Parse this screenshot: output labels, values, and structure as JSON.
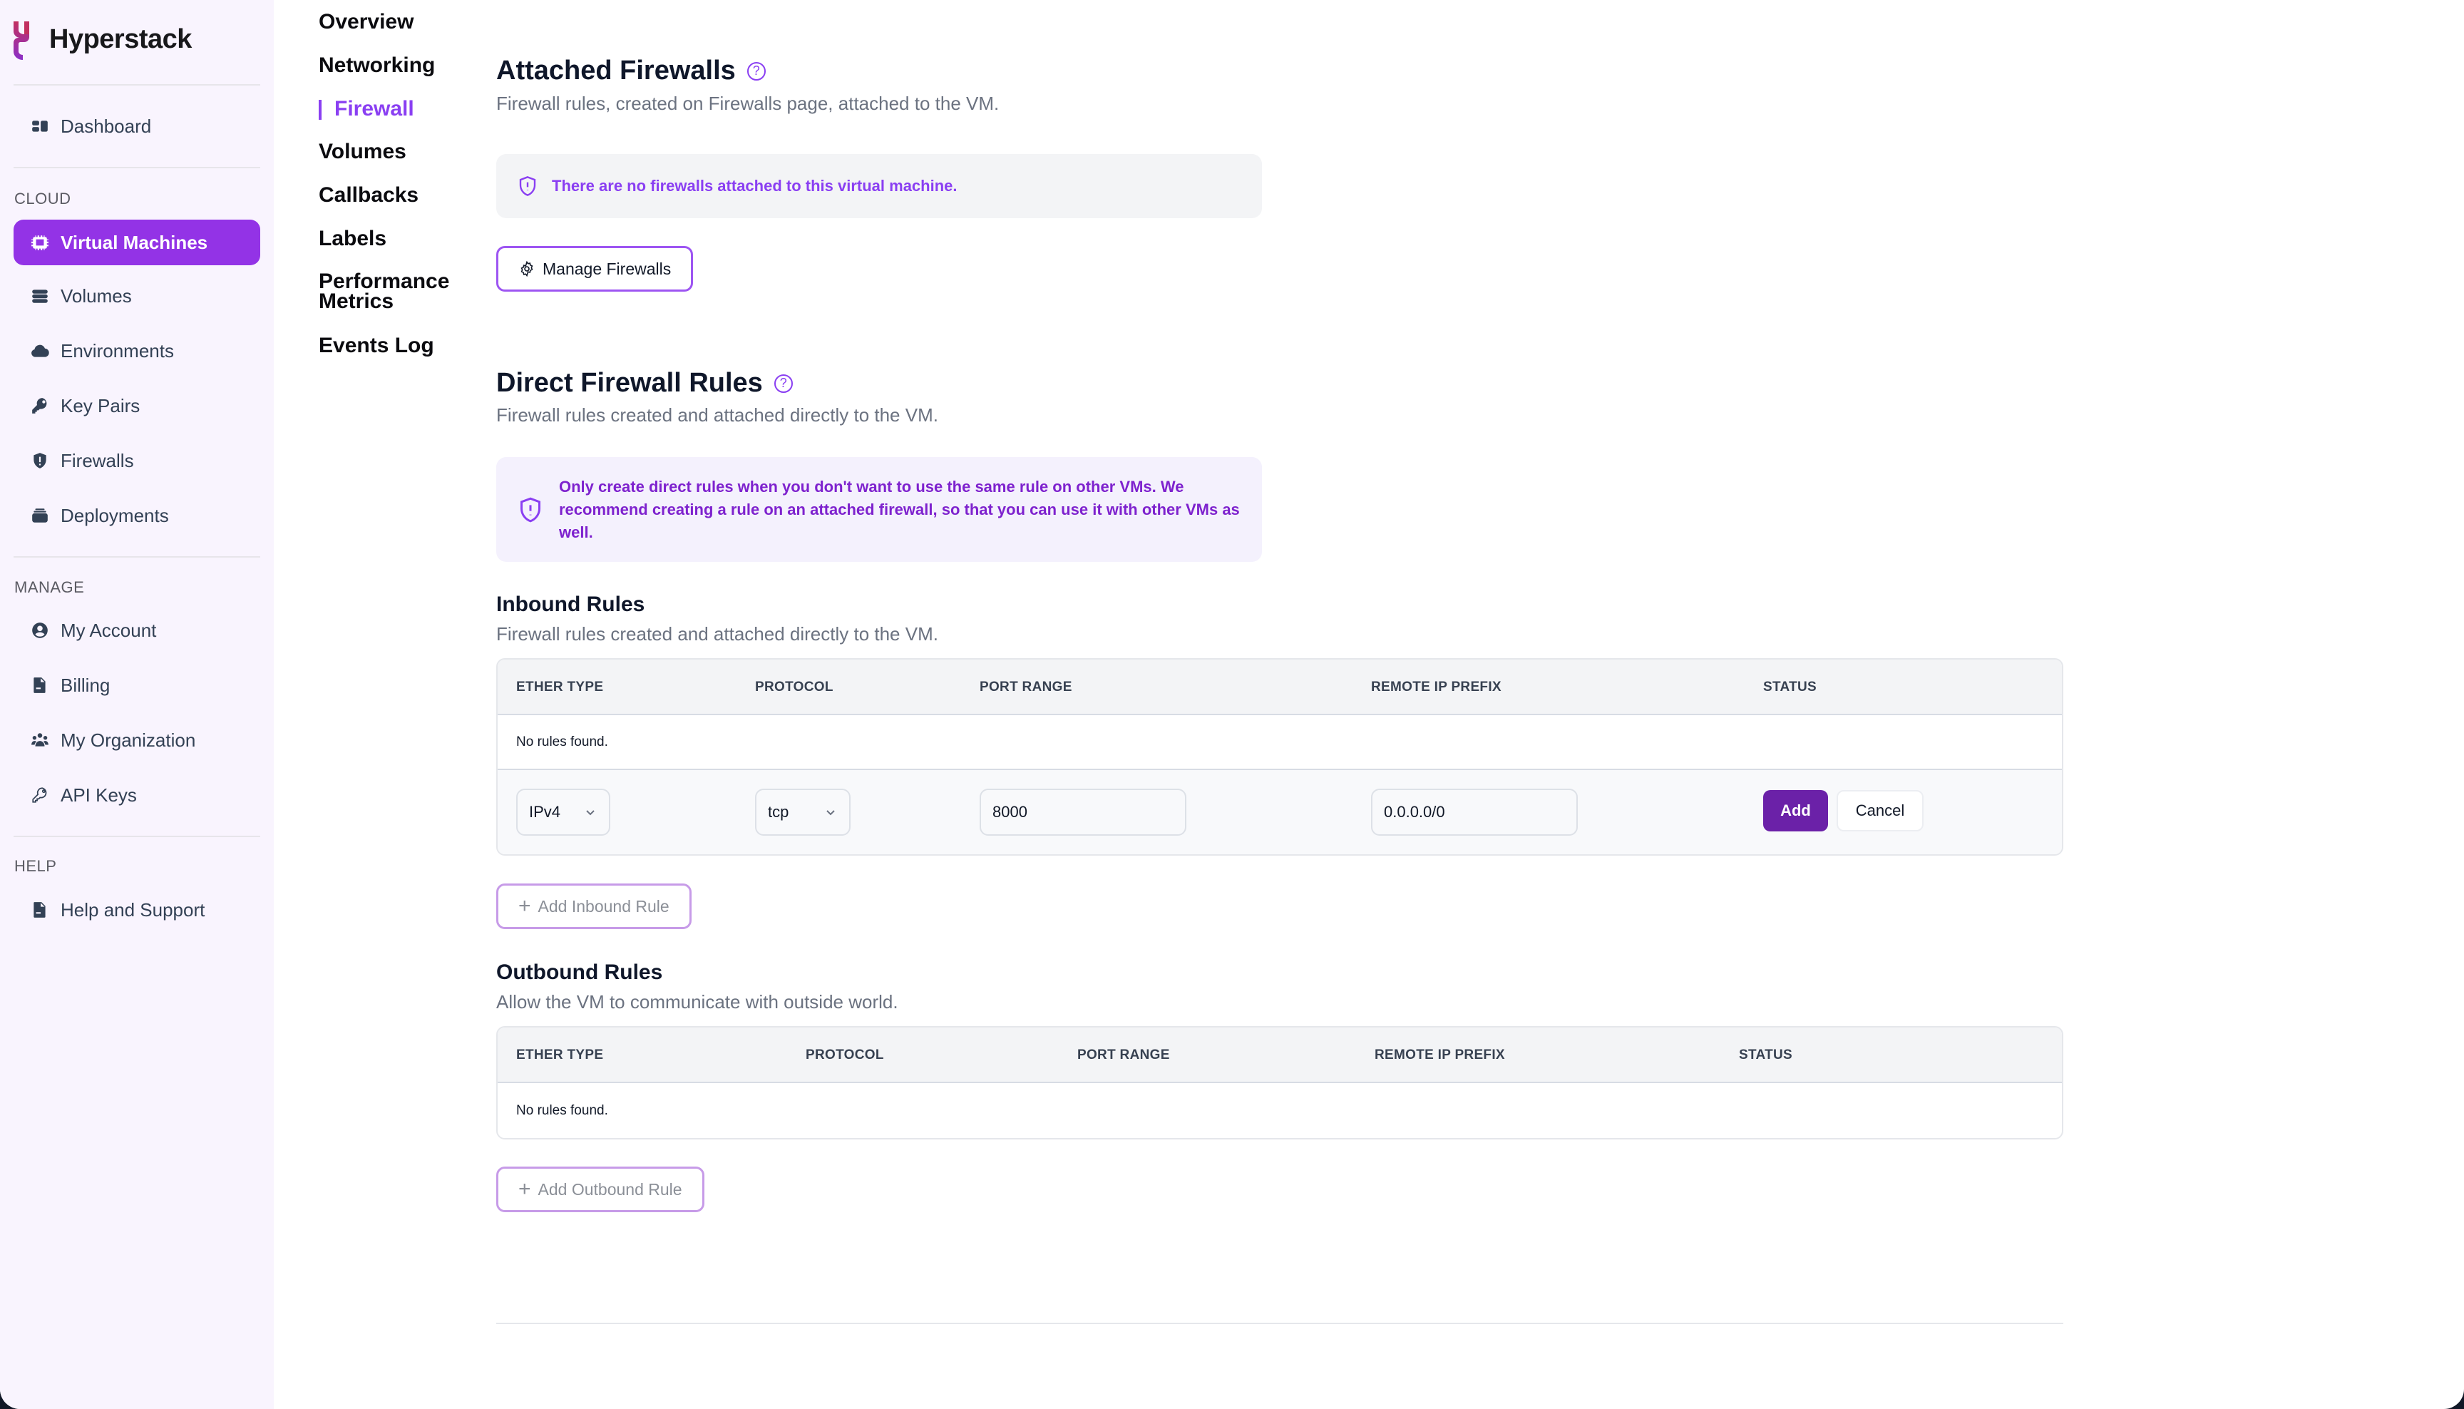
{
  "app": {
    "name": "Hyperstack"
  },
  "colors": {
    "accent": "#9333e6",
    "accent_text": "#8a3ff2",
    "primary_button": "#6b21a8",
    "sidebar_bg": "#f9f4fe"
  },
  "sidebar": {
    "top_items": [
      {
        "label": "Dashboard",
        "icon": "dashboard-icon"
      }
    ],
    "sections": [
      {
        "label": "CLOUD",
        "items": [
          {
            "label": "Virtual Machines",
            "icon": "cpu-chip-icon",
            "active": true
          },
          {
            "label": "Volumes",
            "icon": "server-stack-icon"
          },
          {
            "label": "Environments",
            "icon": "cloud-icon"
          },
          {
            "label": "Key Pairs",
            "icon": "key-icon"
          },
          {
            "label": "Firewalls",
            "icon": "shield-icon"
          },
          {
            "label": "Deployments",
            "icon": "stack-icon"
          }
        ]
      },
      {
        "label": "MANAGE",
        "items": [
          {
            "label": "My Account",
            "icon": "user-circle-icon"
          },
          {
            "label": "Billing",
            "icon": "document-icon"
          },
          {
            "label": "My Organization",
            "icon": "users-icon"
          },
          {
            "label": "API Keys",
            "icon": "key-outline-icon"
          }
        ]
      },
      {
        "label": "HELP",
        "items": [
          {
            "label": "Help and Support",
            "icon": "document-icon"
          }
        ]
      }
    ]
  },
  "subnav": {
    "items": [
      {
        "label": "Overview"
      },
      {
        "label": "Networking"
      },
      {
        "label": "Firewall",
        "active": true
      },
      {
        "label": "Volumes"
      },
      {
        "label": "Callbacks"
      },
      {
        "label": "Labels"
      },
      {
        "label": "Performance Metrics",
        "line1": "Performance",
        "line2": "Metrics"
      },
      {
        "label": "Events Log"
      }
    ]
  },
  "attached": {
    "title": "Attached Firewalls",
    "help": "?",
    "subtitle": "Firewall rules, created on Firewalls page, attached to the VM.",
    "notice": "There are no firewalls attached to this virtual machine.",
    "manage_button": "Manage Firewalls"
  },
  "direct": {
    "title": "Direct Firewall Rules",
    "help": "?",
    "subtitle": "Firewall rules created and attached directly to the VM.",
    "notice": "Only create direct rules when you don't want to use the same rule on other VMs. We recommend creating a rule on an attached firewall, so that you can use it with other VMs as well."
  },
  "inbound": {
    "title": "Inbound Rules",
    "subtitle": "Firewall rules created and attached directly to the VM.",
    "columns": [
      "ETHER TYPE",
      "PROTOCOL",
      "PORT RANGE",
      "REMOTE IP PREFIX",
      "STATUS"
    ],
    "empty_text": "No rules found.",
    "new_rule": {
      "ether_type": "IPv4",
      "protocol": "tcp",
      "port_range": "8000",
      "remote_ip_prefix": "0.0.0.0/0",
      "add_label": "Add",
      "cancel_label": "Cancel"
    },
    "add_button": "Add Inbound Rule"
  },
  "outbound": {
    "title": "Outbound Rules",
    "subtitle": "Allow the VM to communicate with outside world.",
    "columns": [
      "ETHER TYPE",
      "PROTOCOL",
      "PORT RANGE",
      "REMOTE IP PREFIX",
      "STATUS"
    ],
    "empty_text": "No rules found.",
    "add_button": "Add Outbound Rule"
  }
}
